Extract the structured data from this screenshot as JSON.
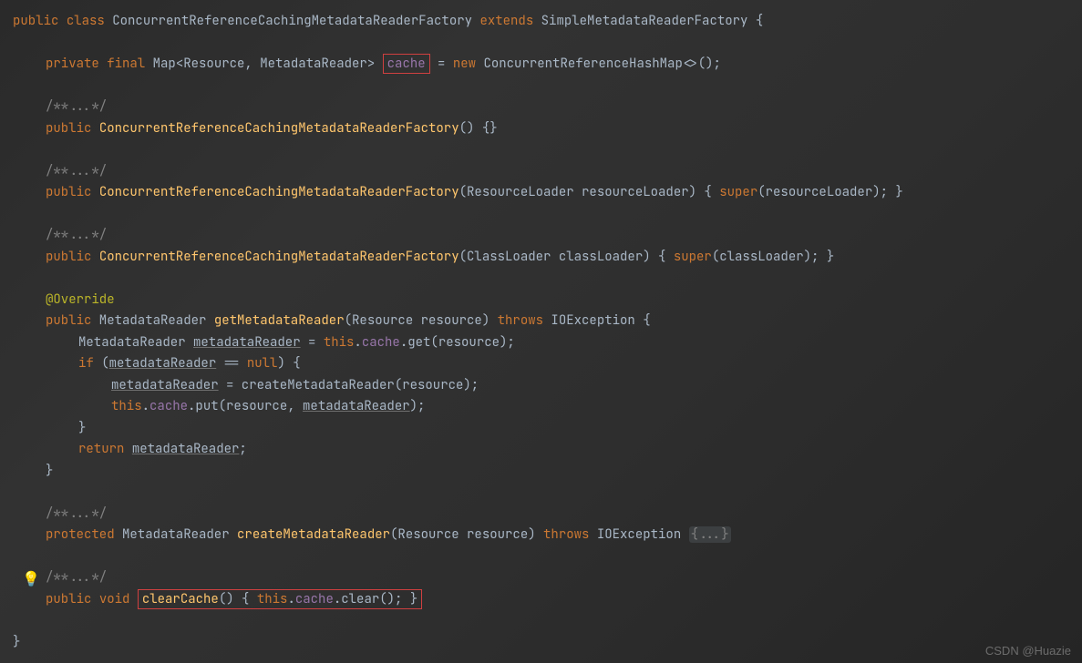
{
  "code": {
    "l1_public": "public",
    "l1_class": "class",
    "l1_name": "ConcurrentReferenceCachingMetadataReaderFactory",
    "l1_extends": "extends",
    "l1_super": "SimpleMetadataReaderFactory {",
    "l3_private": "private",
    "l3_final": "final",
    "l3_map": "Map<Resource, MetadataReader>",
    "l3_cache": "cache",
    "l3_eq": " = ",
    "l3_new": "new",
    "l3_hashmap": " ConcurrentReferenceHashMap<>();",
    "comment_fold": "/**...*/",
    "l6_public": "public",
    "l6_ctor": "ConcurrentReferenceCachingMetadataReaderFactory",
    "l6_end": "() {}",
    "l9_public": "public",
    "l9_ctor": "ConcurrentReferenceCachingMetadataReaderFactory",
    "l9_params": "(ResourceLoader resourceLoader) { ",
    "l9_super": "super",
    "l9_end": "(resourceLoader); }",
    "l12_public": "public",
    "l12_ctor": "ConcurrentReferenceCachingMetadataReaderFactory",
    "l12_params": "(ClassLoader classLoader) { ",
    "l12_super": "super",
    "l12_end": "(classLoader); }",
    "l14_override": "@Override",
    "l15_public": "public",
    "l15_type": " MetadataReader ",
    "l15_method": "getMetadataReader",
    "l15_params": "(Resource resource) ",
    "l15_throws": "throws",
    "l15_exc": " IOException {",
    "l16_a": "MetadataReader ",
    "l16_var": "metadataReader",
    "l16_b": " = ",
    "l16_this": "this",
    "l16_c": ".",
    "l16_cache": "cache",
    "l16_d": ".get(resource);",
    "l17_if": "if",
    "l17_a": " (",
    "l17_var": "metadataReader",
    "l17_b": " == ",
    "l17_null": "null",
    "l17_c": ") {",
    "l18_var": "metadataReader",
    "l18_a": " = createMetadataReader(resource);",
    "l19_this": "this",
    "l19_a": ".",
    "l19_cache": "cache",
    "l19_b": ".put(resource, ",
    "l19_var": "metadataReader",
    "l19_c": ");",
    "l20": "}",
    "l21_return": "return",
    "l21_a": " ",
    "l21_var": "metadataReader",
    "l21_b": ";",
    "l22": "}",
    "l25_protected": "protected",
    "l25_type": " MetadataReader ",
    "l25_method": "createMetadataReader",
    "l25_params": "(Resource resource) ",
    "l25_throws": "throws",
    "l25_exc": " IOException ",
    "l25_fold": "{...}",
    "l28_public": "public",
    "l28_void": "void",
    "l28_method": "clearCache",
    "l28_a": "() { ",
    "l28_this": "this",
    "l28_b": ".",
    "l28_cache": "cache",
    "l28_c": ".clear(); }",
    "l30": "}"
  },
  "watermark": "CSDN @Huazie",
  "bulb_icon": "💡"
}
